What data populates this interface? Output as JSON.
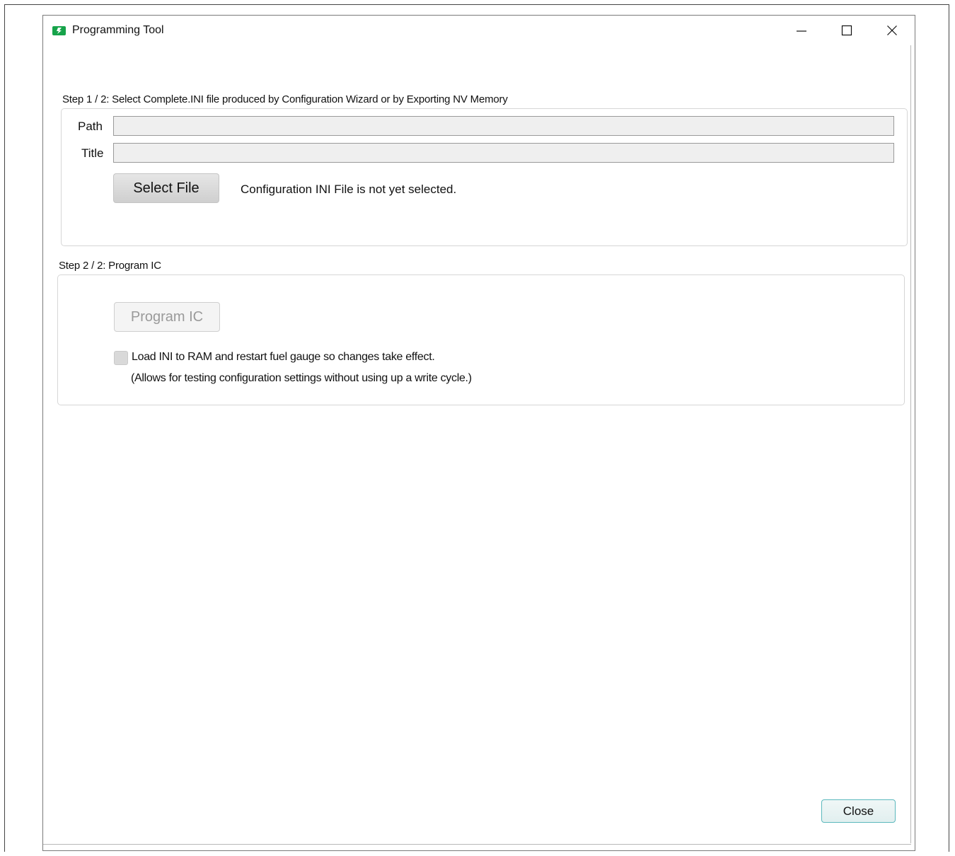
{
  "window": {
    "title": "Programming Tool",
    "minimize_label": "Minimize",
    "maximize_label": "Maximize",
    "close_label": "Close window"
  },
  "step1": {
    "label": "Step 1 / 2: Select Complete.INI file produced by Configuration Wizard or by Exporting NV Memory",
    "path_label": "Path",
    "path_value": "",
    "title_label": "Title",
    "title_value": "",
    "select_button_label": "Select File",
    "status_text": "Configuration INI File is not yet selected."
  },
  "step2": {
    "label": "Step 2 / 2: Program IC",
    "program_button_label": "Program IC",
    "program_button_enabled": false,
    "checkbox_checked": false,
    "checkbox_label": "Load INI to RAM and restart fuel gauge so changes take effect.",
    "checkbox_note": "(Allows for testing configuration settings without using up a write cycle.)"
  },
  "footer": {
    "close_button_label": "Close"
  },
  "colors": {
    "app_icon": "#16a34a",
    "close_button_border": "#5bb8bd",
    "field_background": "#efefef",
    "disabled_text": "#9a9a9a"
  }
}
